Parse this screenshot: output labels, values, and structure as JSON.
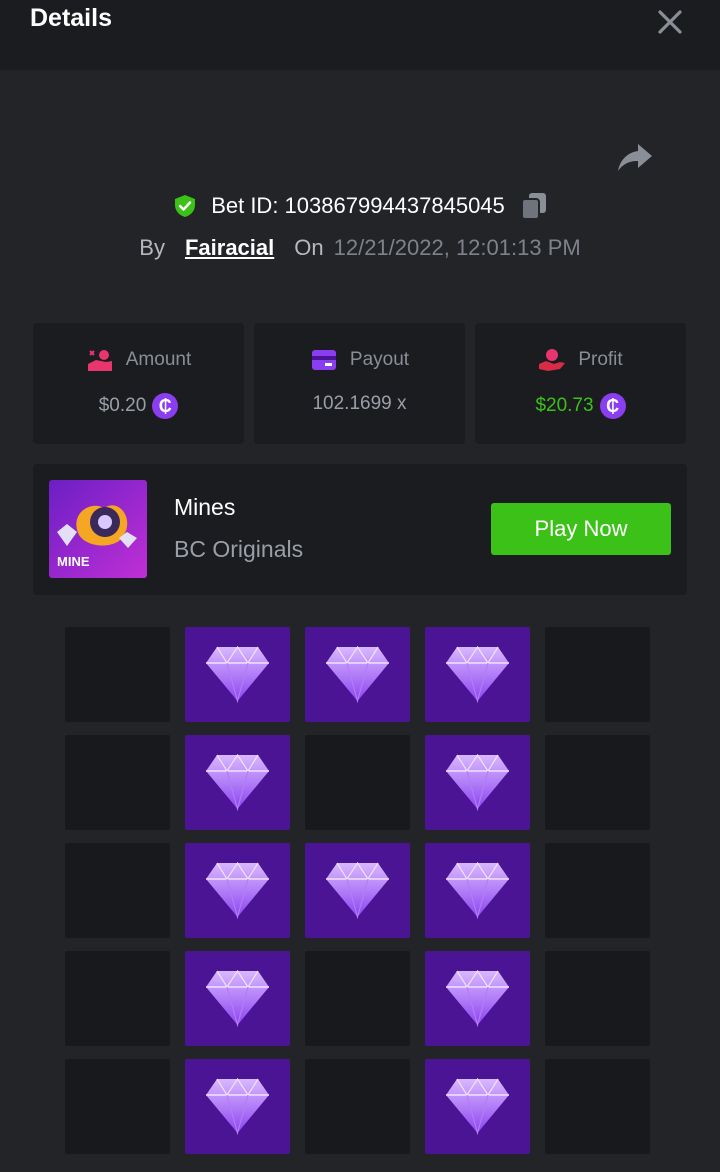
{
  "header": {
    "title": "Details",
    "close_icon": "close-icon"
  },
  "share_icon": "share-icon",
  "bet": {
    "id_text": "Bet ID: 103867994437845045",
    "by_label": "By",
    "user": "Fairacial",
    "on_label": "On",
    "date": "12/21/2022, 12:01:13 PM"
  },
  "stats": [
    {
      "label": "Amount",
      "value": "$0.20",
      "icon": "money-hand-icon",
      "currency": "coin-icon"
    },
    {
      "label": "Payout",
      "value": "102.1699 x",
      "icon": "card-icon"
    },
    {
      "label": "Profit",
      "value": "$20.73",
      "icon": "profit-hand-icon",
      "currency": "coin-icon",
      "value_color": "#3bc117"
    }
  ],
  "coin_symbol": "₵",
  "game": {
    "name": "Mines",
    "provider": "BC Originals",
    "thumb_text": "MINE",
    "play_label": "Play Now",
    "play_color": "#3bc117"
  },
  "grid": {
    "rows": 5,
    "cols": 5,
    "tiles": [
      [
        0,
        1,
        1,
        1,
        0
      ],
      [
        0,
        1,
        0,
        1,
        0
      ],
      [
        0,
        1,
        1,
        1,
        0
      ],
      [
        0,
        1,
        0,
        1,
        0
      ],
      [
        0,
        1,
        0,
        1,
        0
      ]
    ],
    "gem_color": "#4a1495"
  }
}
